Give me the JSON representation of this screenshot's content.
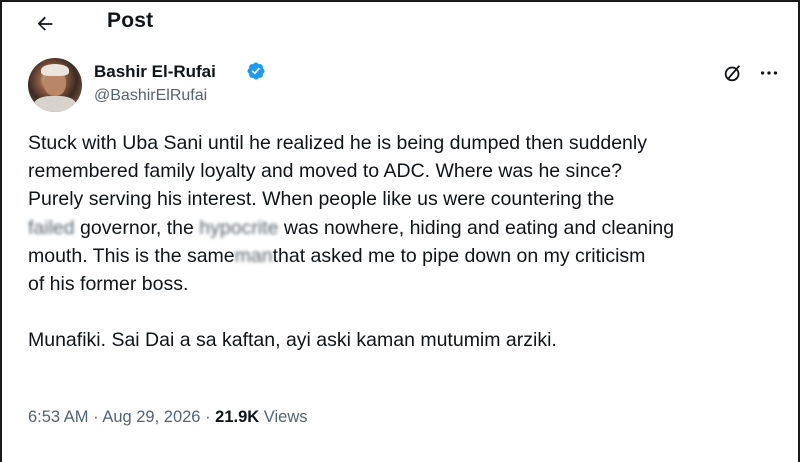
{
  "header": {
    "title": "Post",
    "back_icon": "arrow-left-icon"
  },
  "author": {
    "display_name": "Bashir El-Rufai",
    "handle": "@BashirElRufai",
    "verified": true,
    "verified_color": "#1d9bf0",
    "icons": [
      "verified-badge-icon",
      "grok-icon",
      "more-icon"
    ]
  },
  "post": {
    "lines": [
      "Stuck with Uba Sani until he realized he is being dumped then suddenly",
      "remembered family loyalty and moved to ADC. Where was he since?",
      "Purely serving his interest. When people like us were countering the"
    ],
    "line4_pre": "",
    "line4_blur1": "failed",
    "line4_mid1": " governor, the ",
    "line4_blur2": "hypocrite",
    "line4_post": " was nowhere, hiding and eating and cleaning",
    "line5": "mouth. This is the same",
    "line5_blur": " man ",
    "line5_post": "that asked me to pipe down on my criticism",
    "line6": "of his former boss.",
    "paragraph2": "Munafiki. Sai Dai a sa kaftan, ayi aski kaman mutumim arziki."
  },
  "meta": {
    "time": "6:53 AM",
    "separator1": " · ",
    "date": "Aug 29, 2026",
    "separator2": " · ",
    "views_count": "21.9K",
    "views_label": " Views"
  },
  "colors": {
    "text_primary": "#0f1419",
    "text_secondary": "#536471",
    "accent": "#1d9bf0"
  }
}
